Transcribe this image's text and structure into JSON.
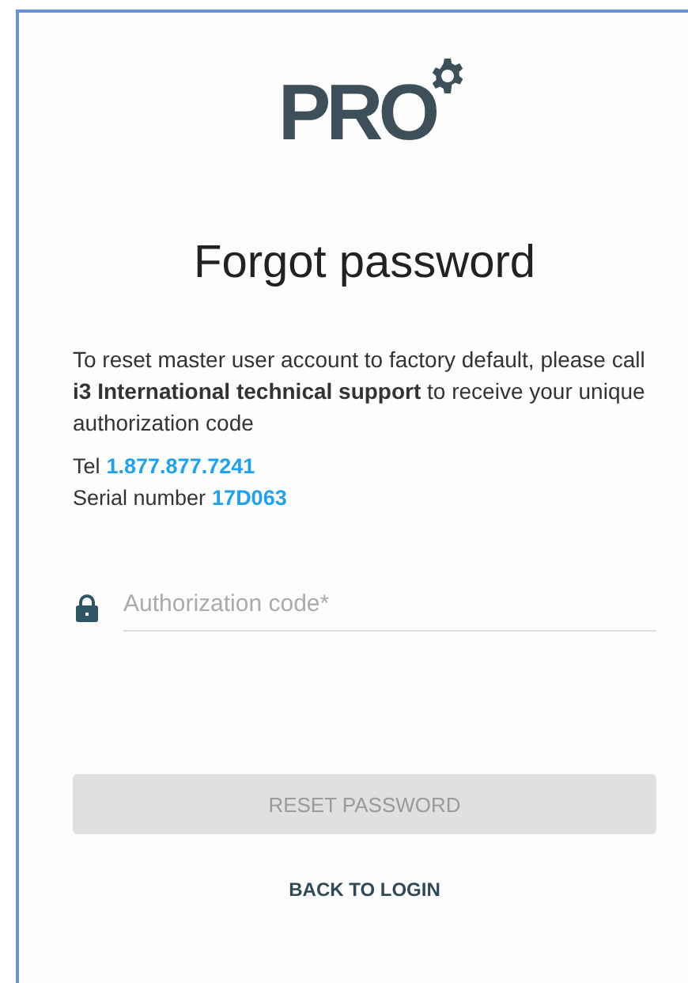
{
  "logo": {
    "text": "PRO"
  },
  "title": "Forgot password",
  "description": "To reset master user account to factory default, please call **i3 International technical support** to receive your unique authorization code",
  "contact": [
    {
      "label": "Tel",
      "value": "1.877.877.7241"
    },
    {
      "label": "Serial number",
      "value": "17D063"
    }
  ],
  "field": {
    "placeholder": "Authorization code*"
  },
  "reset_button": {
    "label": "RESET PASSWORD",
    "disabled": true
  },
  "back_link": "BACK TO LOGIN"
}
